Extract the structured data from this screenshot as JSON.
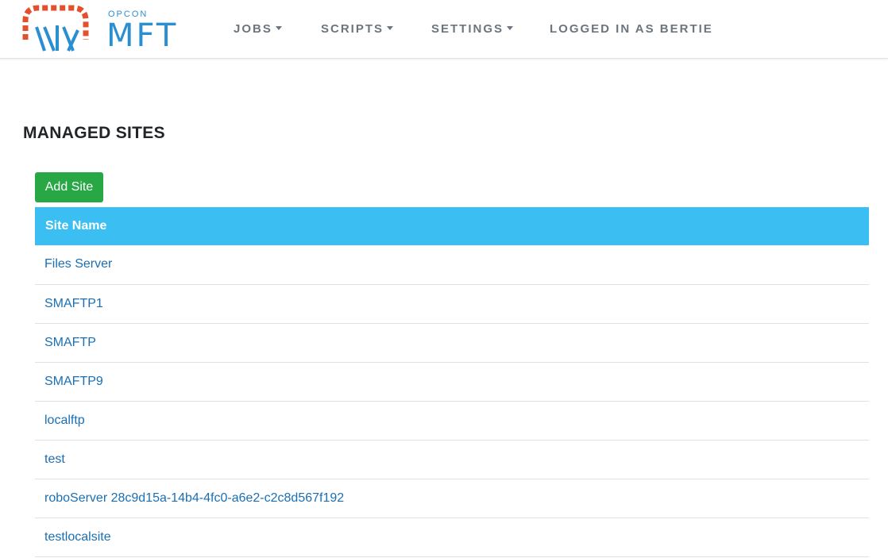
{
  "brand": {
    "small": "OPCON",
    "big": "MFT",
    "logo_icon": "opcon-mft-logo-icon"
  },
  "nav": {
    "jobs": "JOBS",
    "scripts": "SCRIPTS",
    "settings": "SETTINGS",
    "user": "LOGGED IN AS BERTIE"
  },
  "page": {
    "title": "MANAGED SITES"
  },
  "actions": {
    "add_site": "Add Site"
  },
  "table": {
    "header": "Site Name",
    "rows": [
      "Files Server",
      "SMAFTP1",
      "SMAFTP",
      "SMAFTP9",
      "localftp",
      "test",
      "roboServer 28c9d15a-14b4-4fc0-a6e2-c2c8d567f192",
      "testlocalsite"
    ]
  },
  "colors": {
    "header_bg": "#3bbff3",
    "add_button": "#28a745",
    "link": "#1a6fb4",
    "logo_red": "#e4502c",
    "logo_blue": "#2a8fd0"
  }
}
